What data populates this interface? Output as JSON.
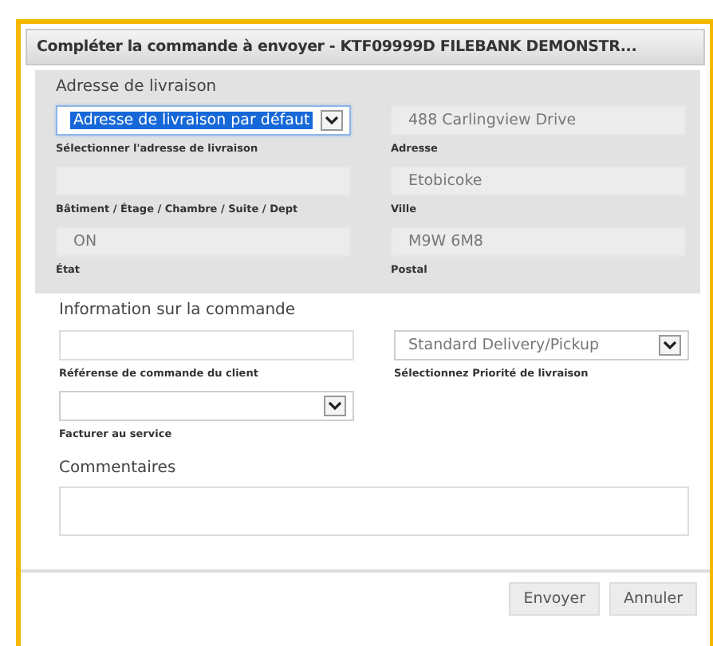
{
  "window": {
    "title": "Compléter la commande à envoyer - KTF09999D FILEBANK DEMONSTR..."
  },
  "shipping_address": {
    "heading": "Adresse de livraison",
    "fields": [
      {
        "kind": "select",
        "value": "Adresse de livraison par défaut",
        "label": "Sélectionner l'adresse de livraison",
        "focused": true
      },
      {
        "kind": "readonly",
        "label": "Bâtiment / Étage / Chambre / Suite / Dept",
        "focused": false
      },
      {
        "kind": "readonly",
        "value": "ON",
        "label": "État",
        "focused": false
      },
      {
        "kind": "readonly",
        "value": "488 Carlingview Drive",
        "label": "Adresse",
        "focused": false
      },
      {
        "kind": "readonly",
        "value": "Etobicoke",
        "label": "Ville",
        "focused": false
      },
      {
        "kind": "readonly",
        "value": "M9W 6M8",
        "label": "Postal",
        "focused": false
      }
    ]
  },
  "order_info": {
    "heading": "Information sur la commande",
    "fields": [
      {
        "kind": "text",
        "label": "Référense de commande du client"
      },
      {
        "kind": "select",
        "value": "Standard Delivery/Pickup",
        "label": "Sélectionnez Priorité de livraison"
      },
      {
        "kind": "select",
        "label": "Facturer au service"
      }
    ]
  },
  "comments": {
    "heading": "Commentaires"
  },
  "buttons": [
    "Envoyer",
    "Annuler"
  ]
}
